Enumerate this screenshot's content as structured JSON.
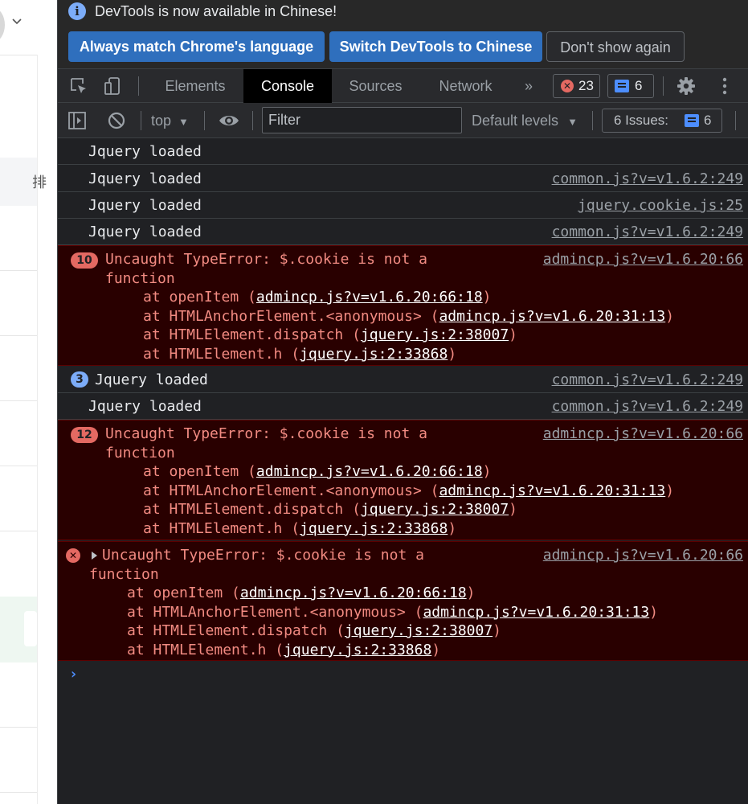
{
  "infobar": {
    "message": "DevTools is now available in Chinese!",
    "info_glyph": "i",
    "buttons": {
      "match": "Always match Chrome's language",
      "switch": "Switch DevTools to Chinese",
      "dismiss": "Don't show again"
    }
  },
  "tabs": {
    "elements": "Elements",
    "console": "Console",
    "sources": "Sources",
    "network": "Network",
    "more": "»",
    "error_count": "23",
    "message_count": "6",
    "error_glyph": "✕"
  },
  "toolbar": {
    "context": "top",
    "context_arrow": "▼",
    "filter_placeholder": "Filter",
    "levels": "Default levels",
    "levels_arrow": "▼",
    "issues_label": "6 Issues:",
    "issues_count": "6"
  },
  "console": {
    "rows": [
      {
        "text": "Jquery loaded",
        "source": ""
      },
      {
        "text": "Jquery loaded",
        "source": "common.js?v=v1.6.2:249"
      },
      {
        "text": "Jquery loaded",
        "source": "jquery.cookie.js:25"
      },
      {
        "text": "Jquery loaded",
        "source": "common.js?v=v1.6.2:249"
      }
    ],
    "error1": {
      "count": "10",
      "line1": "Uncaught TypeError: $.cookie is not a",
      "line2": "function",
      "source": "admincp.js?v=v1.6.20:66",
      "stack": [
        {
          "prefix": "at openItem (",
          "link": "admincp.js?v=v1.6.20:66:18",
          "suffix": ")"
        },
        {
          "prefix": "at HTMLAnchorElement.<anonymous> (",
          "link": "admincp.js?v=v1.6.20:31:13",
          "suffix": ")"
        },
        {
          "prefix": "at HTMLElement.dispatch (",
          "link": "jquery.js:2:38007",
          "suffix": ")"
        },
        {
          "prefix": "at HTMLElement.h (",
          "link": "jquery.js:2:33868",
          "suffix": ")"
        }
      ]
    },
    "grouped": {
      "count": "3",
      "text": "Jquery loaded",
      "source": "common.js?v=v1.6.2:249"
    },
    "row_after": {
      "text": "Jquery loaded",
      "source": "common.js?v=v1.6.2:249"
    },
    "error2": {
      "count": "12",
      "line1": "Uncaught TypeError: $.cookie is not a",
      "line2": "function",
      "source": "admincp.js?v=v1.6.20:66",
      "stack": [
        {
          "prefix": "at openItem (",
          "link": "admincp.js?v=v1.6.20:66:18",
          "suffix": ")"
        },
        {
          "prefix": "at HTMLAnchorElement.<anonymous> (",
          "link": "admincp.js?v=v1.6.20:31:13",
          "suffix": ")"
        },
        {
          "prefix": "at HTMLElement.dispatch (",
          "link": "jquery.js:2:38007",
          "suffix": ")"
        },
        {
          "prefix": "at HTMLElement.h (",
          "link": "jquery.js:2:33868",
          "suffix": ")"
        }
      ]
    },
    "error3": {
      "icon": "✕",
      "line1": "Uncaught TypeError: $.cookie is not a",
      "line2": "function",
      "source": "admincp.js?v=v1.6.20:66",
      "stack": [
        {
          "prefix": "at openItem (",
          "link": "admincp.js?v=v1.6.20:66:18",
          "suffix": ")"
        },
        {
          "prefix": "at HTMLAnchorElement.<anonymous> (",
          "link": "admincp.js?v=v1.6.20:31:13",
          "suffix": ")"
        },
        {
          "prefix": "at HTMLElement.dispatch (",
          "link": "jquery.js:2:38007",
          "suffix": ")"
        },
        {
          "prefix": "at HTMLElement.h (",
          "link": "jquery.js:2:33868",
          "suffix": ")"
        }
      ]
    },
    "prompt": "›"
  },
  "colors": {
    "panel_bg": "#202124",
    "error_bg": "#290000",
    "error_text": "#f28b82",
    "primary_button": "#2f6fbd",
    "accent_blue": "#4d8eff"
  },
  "icons": [
    "info-icon",
    "inspect-element-icon",
    "device-toolbar-icon",
    "more-tabs-icon",
    "error-icon",
    "message-icon",
    "settings-gear-icon",
    "kebab-menu-icon",
    "sidebar-toggle-icon",
    "clear-console-icon",
    "dropdown-arrow-icon",
    "live-expression-eye-icon",
    "expand-triangle-icon",
    "chevron-down-icon"
  ]
}
